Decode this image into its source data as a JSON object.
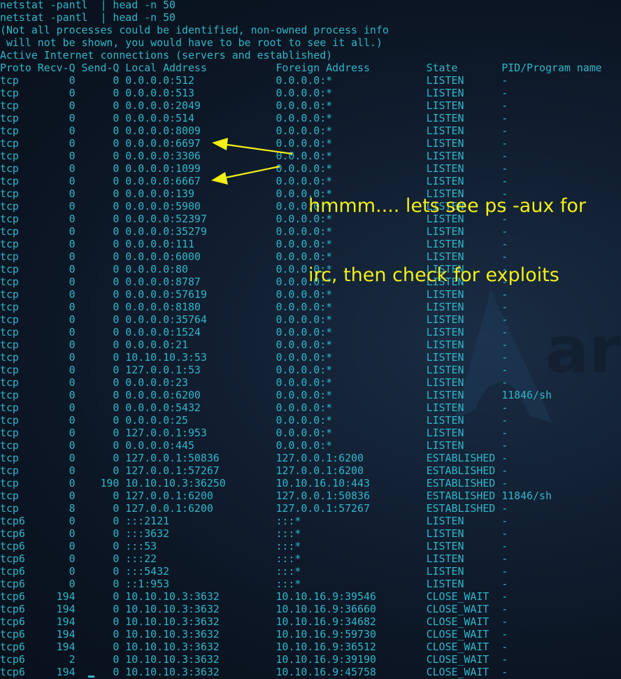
{
  "terminal": {
    "lines": [
      "netstat -pantl  | head -n 50",
      "netstat -pantl  | head -n 50",
      "(Not all processes could be identified, non-owned process info",
      " will not be shown, you would have to be root to see it all.)",
      "Active Internet connections (servers and established)",
      "Proto Recv-Q Send-Q Local Address           Foreign Address         State       PID/Program name",
      "tcp        0      0 0.0.0.0:512             0.0.0.0:*               LISTEN      -",
      "tcp        0      0 0.0.0.0:513             0.0.0.0:*               LISTEN      -",
      "tcp        0      0 0.0.0.0:2049            0.0.0.0:*               LISTEN      -",
      "tcp        0      0 0.0.0.0:514             0.0.0.0:*               LISTEN      -",
      "tcp        0      0 0.0.0.0:8009            0.0.0.0:*               LISTEN      -",
      "tcp        0      0 0.0.0.0:6697            0.0.0.0:*               LISTEN      -",
      "tcp        0      0 0.0.0.0:3306            0.0.0.0:*               LISTEN      -",
      "tcp        0      0 0.0.0.0:1099            0.0.0.0:*               LISTEN      -",
      "tcp        0      0 0.0.0.0:6667            0.0.0.0:*               LISTEN      -",
      "tcp        0      0 0.0.0.0:139             0.0.0.0:*               LISTEN      -",
      "tcp        0      0 0.0.0.0:5900            0.0.0.0:*               LISTEN      -",
      "tcp        0      0 0.0.0.0:52397           0.0.0.0:*               LISTEN      -",
      "tcp        0      0 0.0.0.0:35279           0.0.0.0:*               LISTEN      -",
      "tcp        0      0 0.0.0.0:111             0.0.0.0:*               LISTEN      -",
      "tcp        0      0 0.0.0.0:6000            0.0.0.0:*               LISTEN      -",
      "tcp        0      0 0.0.0.0:80              0.0.0.0:*               LISTEN      -",
      "tcp        0      0 0.0.0.0:8787            0.0.0.0:*               LISTEN      -",
      "tcp        0      0 0.0.0.0:57619           0.0.0.0:*               LISTEN      -",
      "tcp        0      0 0.0.0.0:8180            0.0.0.0:*               LISTEN      -",
      "tcp        0      0 0.0.0.0:35764           0.0.0.0:*               LISTEN      -",
      "tcp        0      0 0.0.0.0:1524            0.0.0.0:*               LISTEN      -",
      "tcp        0      0 0.0.0.0:21              0.0.0.0:*               LISTEN      -",
      "tcp        0      0 10.10.10.3:53           0.0.0.0:*               LISTEN      -",
      "tcp        0      0 127.0.0.1:53            0.0.0.0:*               LISTEN      -",
      "tcp        0      0 0.0.0.0:23              0.0.0.0:*               LISTEN      -",
      "tcp        0      0 0.0.0.0:6200            0.0.0.0:*               LISTEN      11846/sh",
      "tcp        0      0 0.0.0.0:5432            0.0.0.0:*               LISTEN      -",
      "tcp        0      0 0.0.0.0:25              0.0.0.0:*               LISTEN      -",
      "tcp        0      0 127.0.0.1:953           0.0.0.0:*               LISTEN      -",
      "tcp        0      0 0.0.0.0:445             0.0.0.0:*               LISTEN      -",
      "tcp        0      0 127.0.0.1:50836         127.0.0.1:6200          ESTABLISHED -",
      "tcp        0      0 127.0.0.1:57267         127.0.0.1:6200          ESTABLISHED -",
      "tcp        0    190 10.10.10.3:36250        10.10.16.10:443         ESTABLISHED -",
      "tcp        0      0 127.0.0.1:6200          127.0.0.1:50836         ESTABLISHED 11846/sh",
      "tcp        8      0 127.0.0.1:6200          127.0.0.1:57267         ESTABLISHED -",
      "tcp6       0      0 :::2121                 :::*                    LISTEN      -",
      "tcp6       0      0 :::3632                 :::*                    LISTEN      -",
      "tcp6       0      0 :::53                   :::*                    LISTEN      -",
      "tcp6       0      0 :::22                   :::*                    LISTEN      -",
      "tcp6       0      0 :::5432                 :::*                    LISTEN      -",
      "tcp6       0      0 ::1:953                 :::*                    LISTEN      -",
      "tcp6     194      0 10.10.10.3:3632         10.10.16.9:39546        CLOSE_WAIT  -",
      "tcp6     194      0 10.10.10.3:3632         10.10.16.9:36660        CLOSE_WAIT  -",
      "tcp6     194      0 10.10.10.3:3632         10.10.16.9:34682        CLOSE_WAIT  -",
      "tcp6     194      0 10.10.10.3:3632         10.10.16.9:59730        CLOSE_WAIT  -",
      "tcp6     194      0 10.10.10.3:3632         10.10.16.9:36512        CLOSE_WAIT  -",
      "tcp6       2      0 10.10.10.3:3632         10.10.16.9:39190        CLOSE_WAIT  -",
      "tcp6     194      0 10.10.10.3:3632         10.10.16.9:45758        CLOSE_WAIT  -"
    ]
  },
  "annotation": {
    "line1": "hmmm.... lets see ps -aux for",
    "line2": "irc, then check for exploits"
  },
  "watermark": {
    "text": "ar",
    "icon": "arch-linux-logo-icon"
  },
  "colors": {
    "terminal_text": "#2fb6c7",
    "annotation": "#f2ef16",
    "background": "#0b1523"
  }
}
